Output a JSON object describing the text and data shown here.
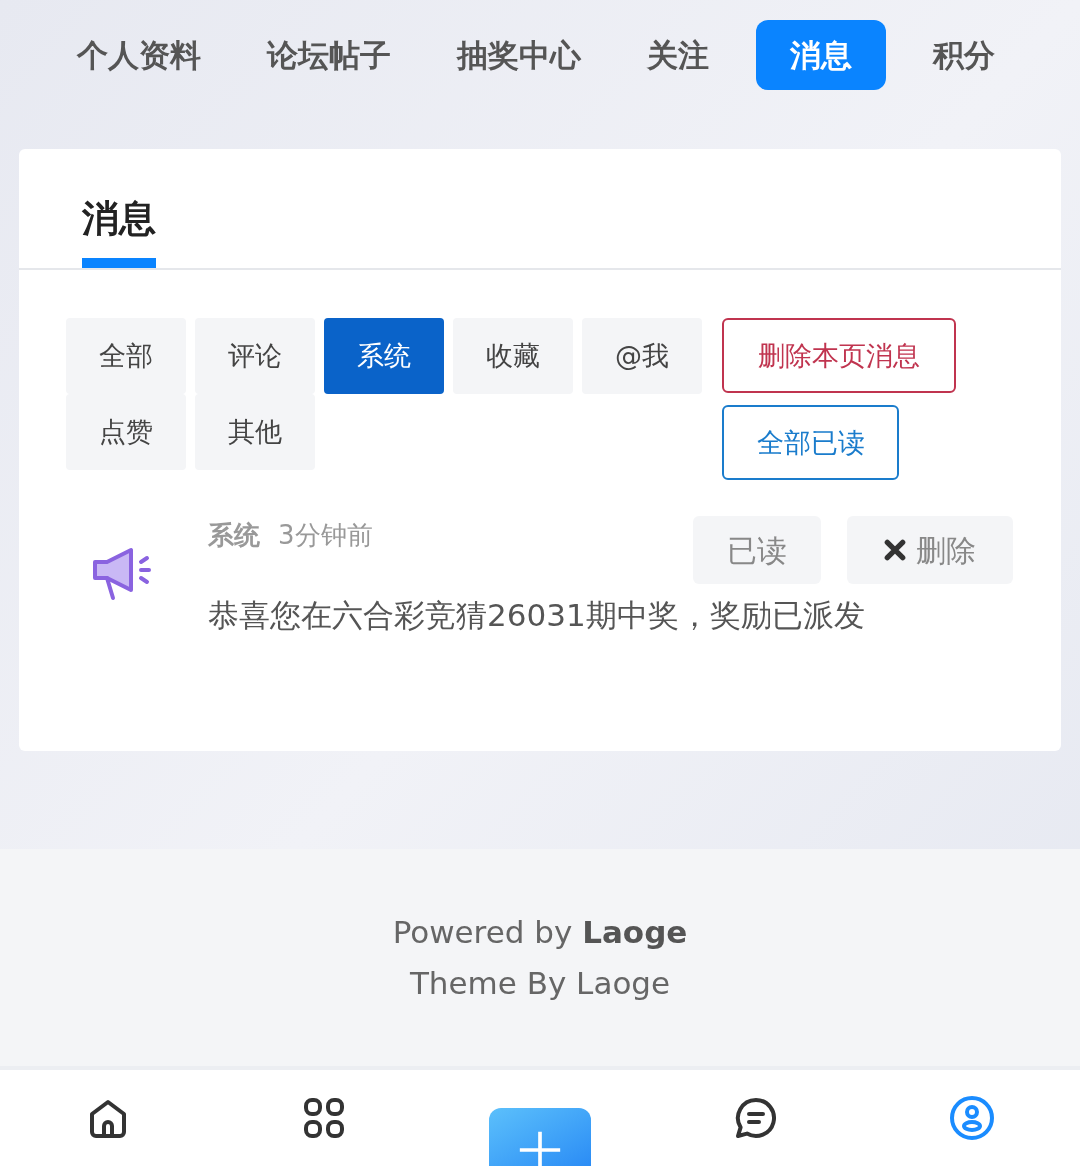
{
  "top_tabs": [
    {
      "label": "个人资料",
      "selected": false
    },
    {
      "label": "论坛帖子",
      "selected": false
    },
    {
      "label": "抽奖中心",
      "selected": false
    },
    {
      "label": "关注",
      "selected": false
    },
    {
      "label": "消息",
      "selected": true
    },
    {
      "label": "积分",
      "selected": false
    }
  ],
  "card": {
    "title": "消息",
    "filters": [
      {
        "label": "全部",
        "selected": false
      },
      {
        "label": "评论",
        "selected": false
      },
      {
        "label": "系统",
        "selected": true
      },
      {
        "label": "收藏",
        "selected": false
      },
      {
        "label": "@我",
        "selected": false
      },
      {
        "label": "点赞",
        "selected": false
      },
      {
        "label": "其他",
        "selected": false
      }
    ],
    "actions": [
      {
        "label": "删除本页消息",
        "kind": "danger"
      },
      {
        "label": "全部已读",
        "kind": "primary"
      }
    ],
    "messages": [
      {
        "type": "系统",
        "time": "3分钟前",
        "text": "恭喜您在六合彩竞猜26031期中奖，奖励已派发",
        "read_button": "已读",
        "delete_button": "删除"
      }
    ]
  },
  "footer": {
    "powered_prefix": "Powered by",
    "powered_name": "Laoge",
    "theme": "Theme By Laoge"
  },
  "bottom_nav": [
    {
      "kind": "home",
      "selected": false
    },
    {
      "kind": "grid",
      "selected": false
    },
    {
      "kind": "plus",
      "selected": false
    },
    {
      "kind": "chat",
      "selected": false
    },
    {
      "kind": "user",
      "selected": true
    }
  ]
}
